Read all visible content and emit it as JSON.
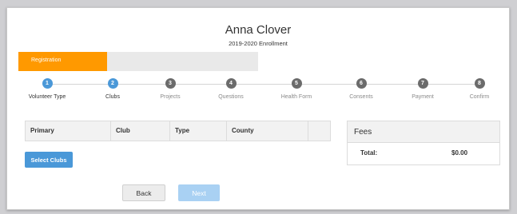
{
  "header": {
    "name": "Anna Clover",
    "subtitle": "2019-2020 Enrollment"
  },
  "progress": {
    "label": "Registration",
    "fraction": 0.37,
    "color": "#ff9900"
  },
  "steps": [
    {
      "number": "1",
      "label": "Volunteer Type",
      "active": true
    },
    {
      "number": "2",
      "label": "Clubs",
      "active": true
    },
    {
      "number": "3",
      "label": "Projects",
      "active": false
    },
    {
      "number": "4",
      "label": "Questions",
      "active": false
    },
    {
      "number": "5",
      "label": "Health Form",
      "active": false
    },
    {
      "number": "6",
      "label": "Consents",
      "active": false
    },
    {
      "number": "7",
      "label": "Payment",
      "active": false
    },
    {
      "number": "8",
      "label": "Confirm",
      "active": false
    }
  ],
  "clubs_table": {
    "columns": [
      "Primary",
      "Club",
      "Type",
      "County",
      ""
    ]
  },
  "fees": {
    "title": "Fees",
    "total_label": "Total:",
    "total_value": "$0.00"
  },
  "buttons": {
    "select_clubs": "Select Clubs",
    "back": "Back",
    "next": "Next"
  },
  "colors": {
    "accent": "#4a98d8",
    "inactive_step": "#6b6b6b",
    "next_disabled": "#a9d1f3"
  }
}
